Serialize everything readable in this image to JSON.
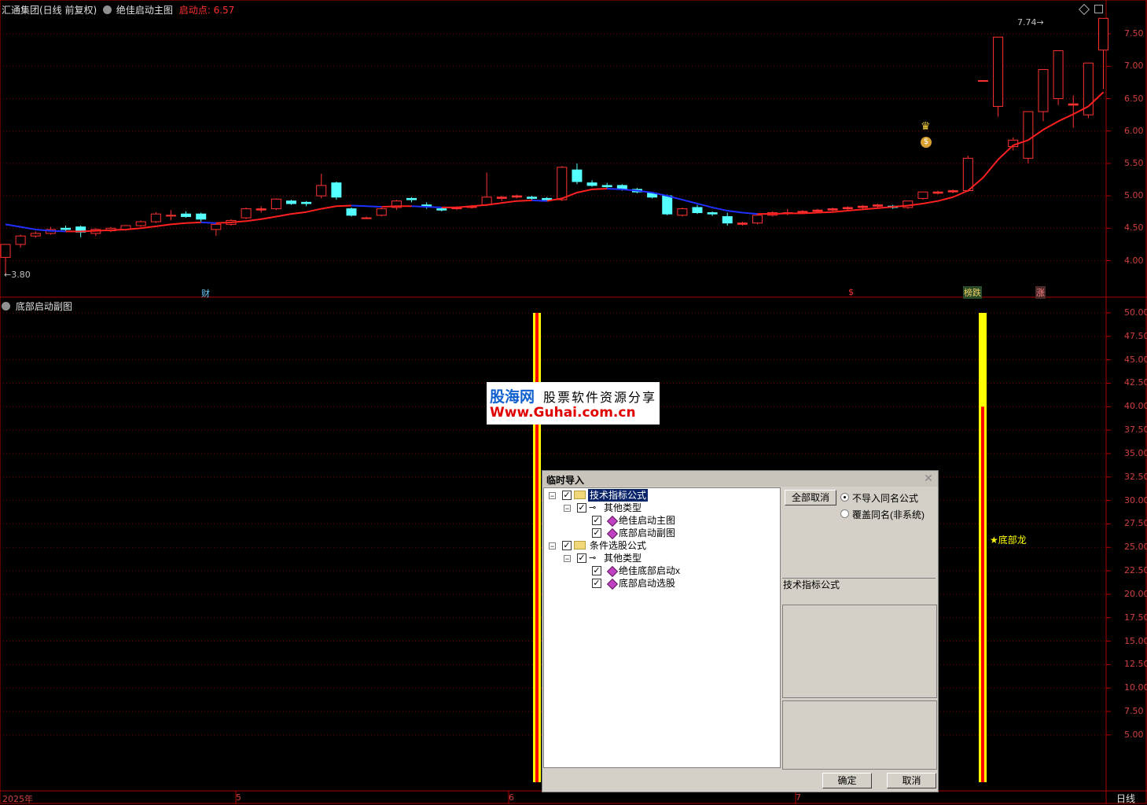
{
  "main_chart": {
    "header": {
      "stock": "汇通集团(日线 前复权)",
      "indicator": "绝佳启动主图",
      "param_label": "启动点:",
      "param_value": "6.57"
    },
    "y_ticks": [
      "7.50",
      "7.00",
      "6.50",
      "6.00",
      "5.50",
      "5.00",
      "4.50",
      "4.00"
    ],
    "low_label": "3.80",
    "high_label": "7.74",
    "markers": [
      "财",
      "$",
      "榜跌",
      "涨"
    ],
    "colors": {
      "up": "#ff3232",
      "down": "#54ffff",
      "ma_up": "#ff2020",
      "ma_down": "#2030ff",
      "grid": "#800000"
    }
  },
  "sub_chart": {
    "title": "底部启动副图",
    "y_ticks": [
      "50.00",
      "47.50",
      "45.00",
      "42.50",
      "40.00",
      "37.50",
      "35.00",
      "32.50",
      "30.00",
      "27.50",
      "25.00",
      "22.50",
      "20.00",
      "17.50",
      "15.00",
      "12.50",
      "10.00",
      "7.50",
      "5.00"
    ],
    "signal_label": "★底部龙"
  },
  "x_axis": {
    "labels": [
      "2025年",
      "5",
      "6",
      "7"
    ],
    "period": "日线"
  },
  "watermark": {
    "name": "股海网",
    "tagline": "股票软件资源分享",
    "url": "Www.Guhai.com.cn"
  },
  "dialog": {
    "title": "临时导入",
    "tree": [
      {
        "label": "技术指标公式",
        "level": 0,
        "type": "folder",
        "selected": true
      },
      {
        "label": "其他类型",
        "level": 1,
        "type": "key"
      },
      {
        "label": "绝佳启动主图",
        "level": 2,
        "type": "item"
      },
      {
        "label": "底部启动副图",
        "level": 2,
        "type": "item"
      },
      {
        "label": "条件选股公式",
        "level": 0,
        "type": "folder"
      },
      {
        "label": "其他类型",
        "level": 1,
        "type": "key"
      },
      {
        "label": "绝佳底部启动x",
        "level": 2,
        "type": "item"
      },
      {
        "label": "底部启动选股",
        "level": 2,
        "type": "item"
      }
    ],
    "deselect_all": "全部取消",
    "option_no_import": "不导入同名公式",
    "option_overwrite": "覆盖同名(非系统)",
    "info_title": "技术指标公式",
    "ok": "确定",
    "cancel": "取消"
  }
}
